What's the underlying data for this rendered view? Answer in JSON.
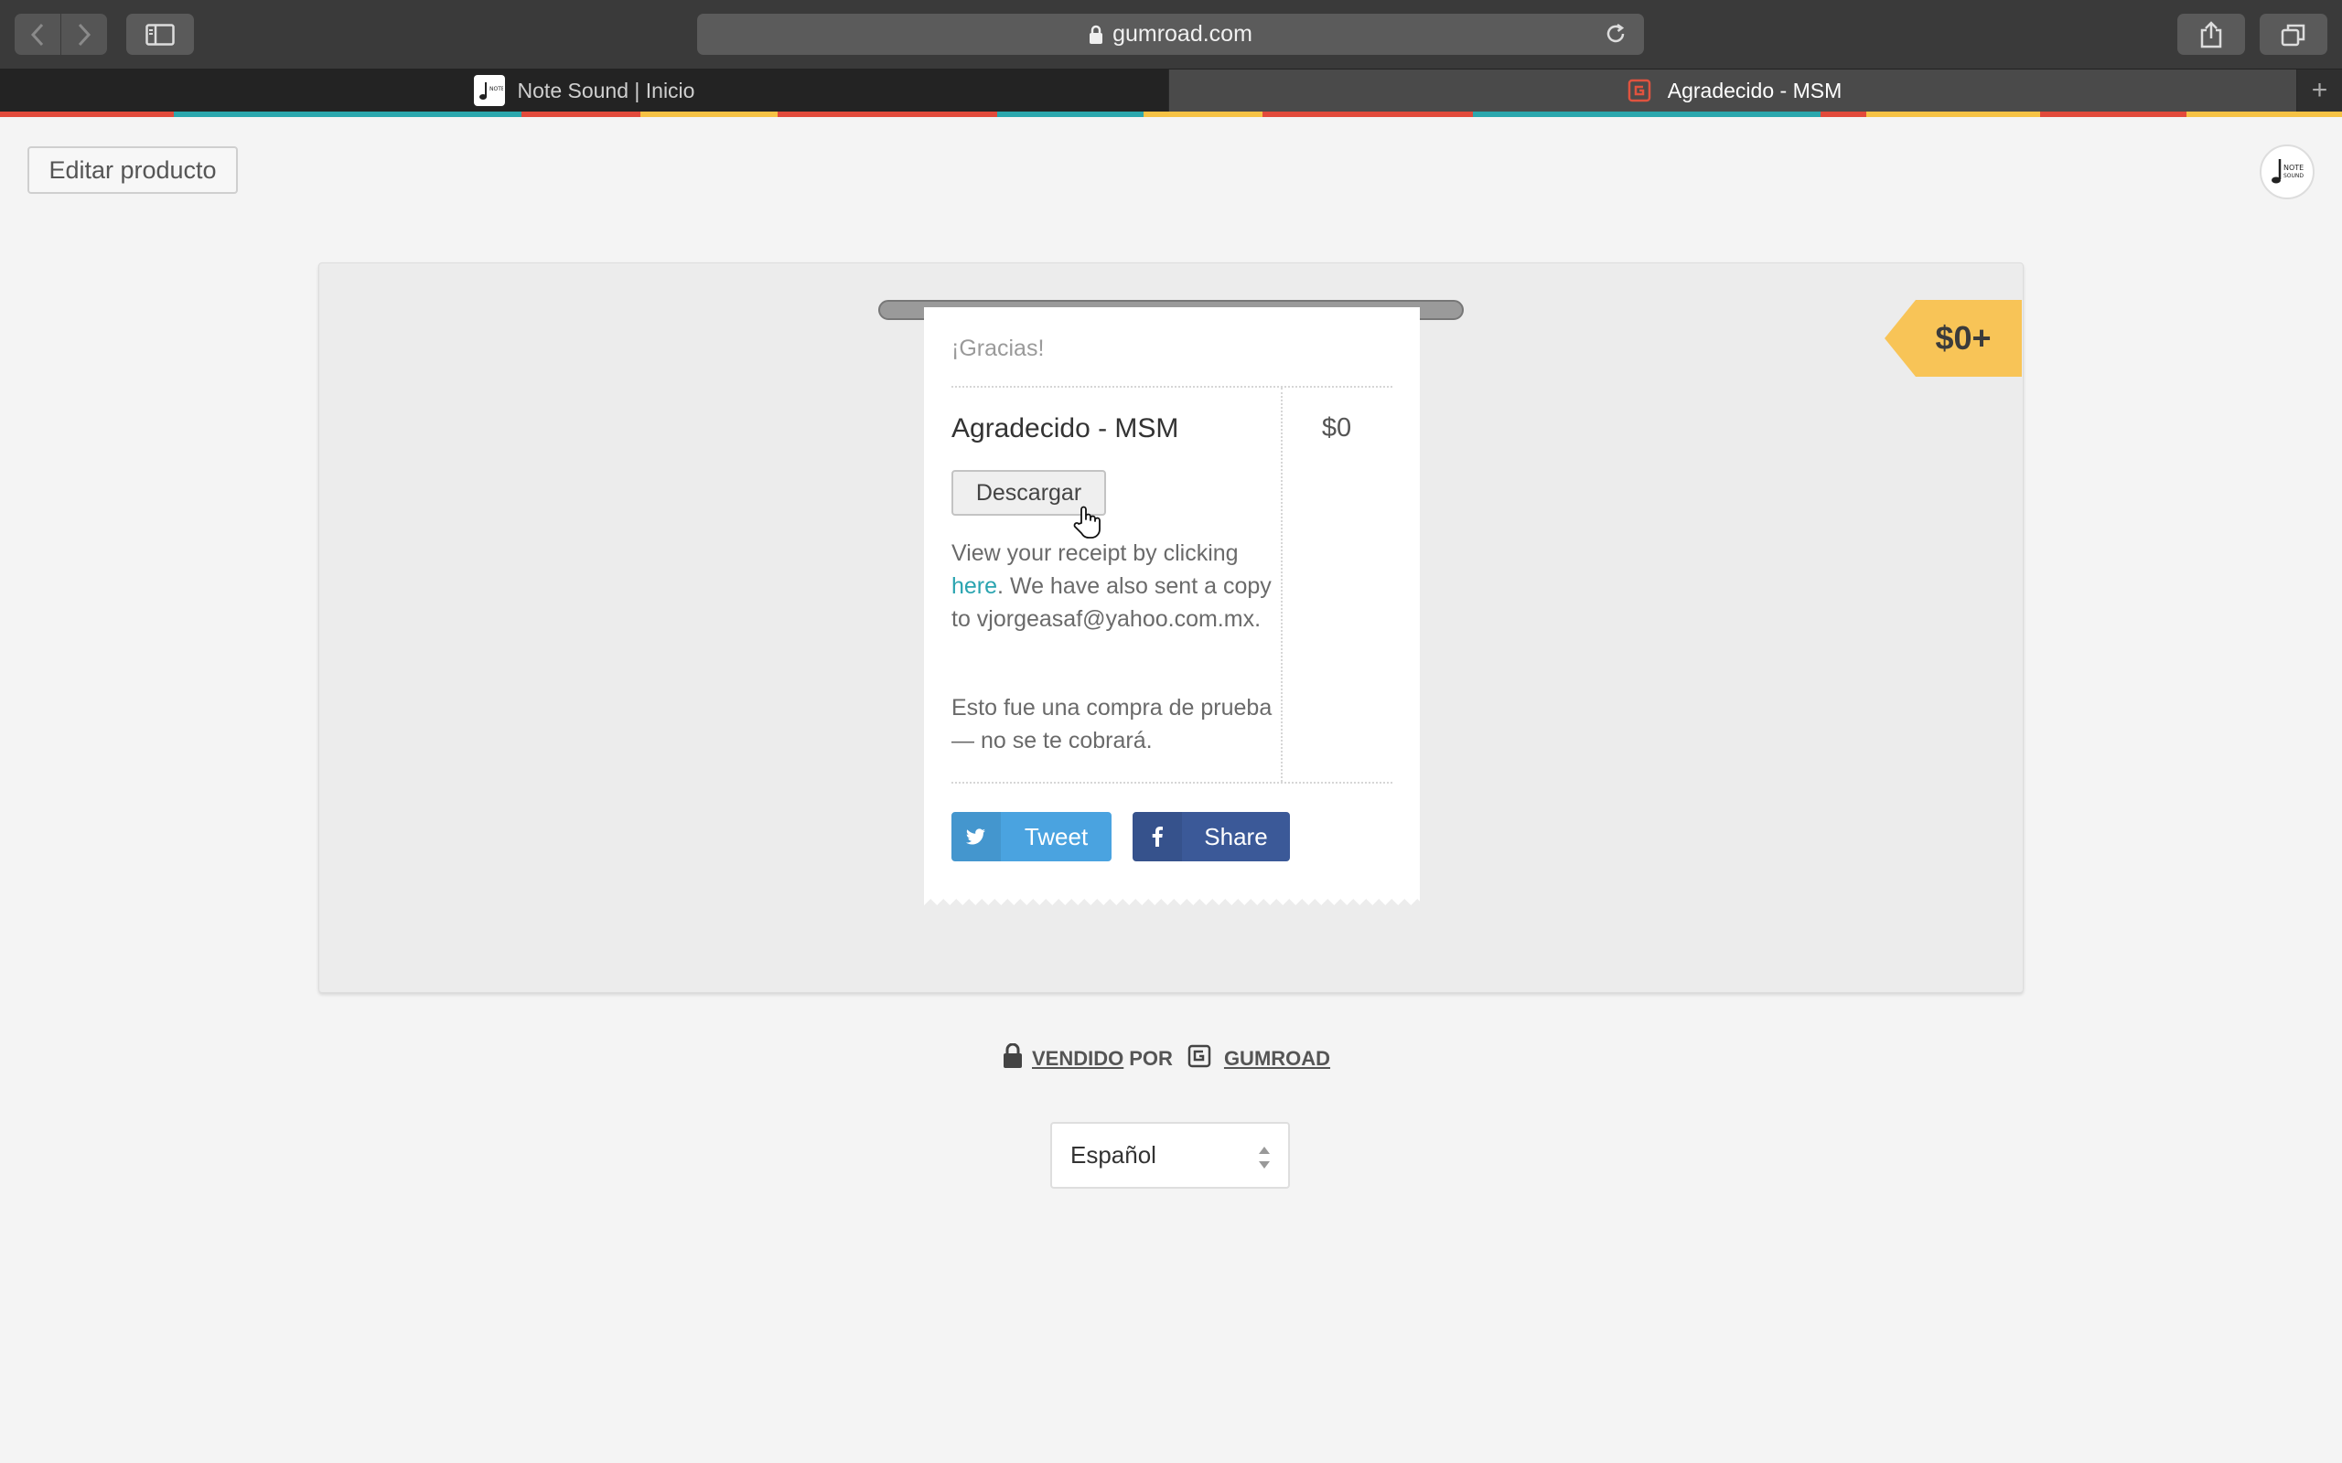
{
  "browser": {
    "url": "gumroad.com",
    "tabs": [
      {
        "label": "Note Sound | Inicio"
      },
      {
        "label": "Agradecido - MSM"
      }
    ],
    "new_tab": "+"
  },
  "page": {
    "edit_button": "Editar producto",
    "price_tag": "$0+",
    "receipt": {
      "thanks": "¡Gracias!",
      "product_name": "Agradecido - MSM",
      "product_price": "$0",
      "download_button": "Descargar",
      "text_before_link": "View your receipt by clicking ",
      "link_text": "here",
      "text_after_link": ". We have also sent a copy to vjorgeasaf@yahoo.com.mx.",
      "test_note": "Esto fue una compra de prueba — no se te cobrará.",
      "tweet_label": "Tweet",
      "share_label": "Share"
    },
    "footer": {
      "sold": "VENDIDO",
      "by": "POR",
      "brand": "GUMROAD"
    },
    "language_select": {
      "value": "Español"
    }
  },
  "colors": {
    "price_tag": "#f8c457",
    "link": "#2aa4b0",
    "twitter": "#4aa3e0",
    "facebook": "#3b5998"
  }
}
